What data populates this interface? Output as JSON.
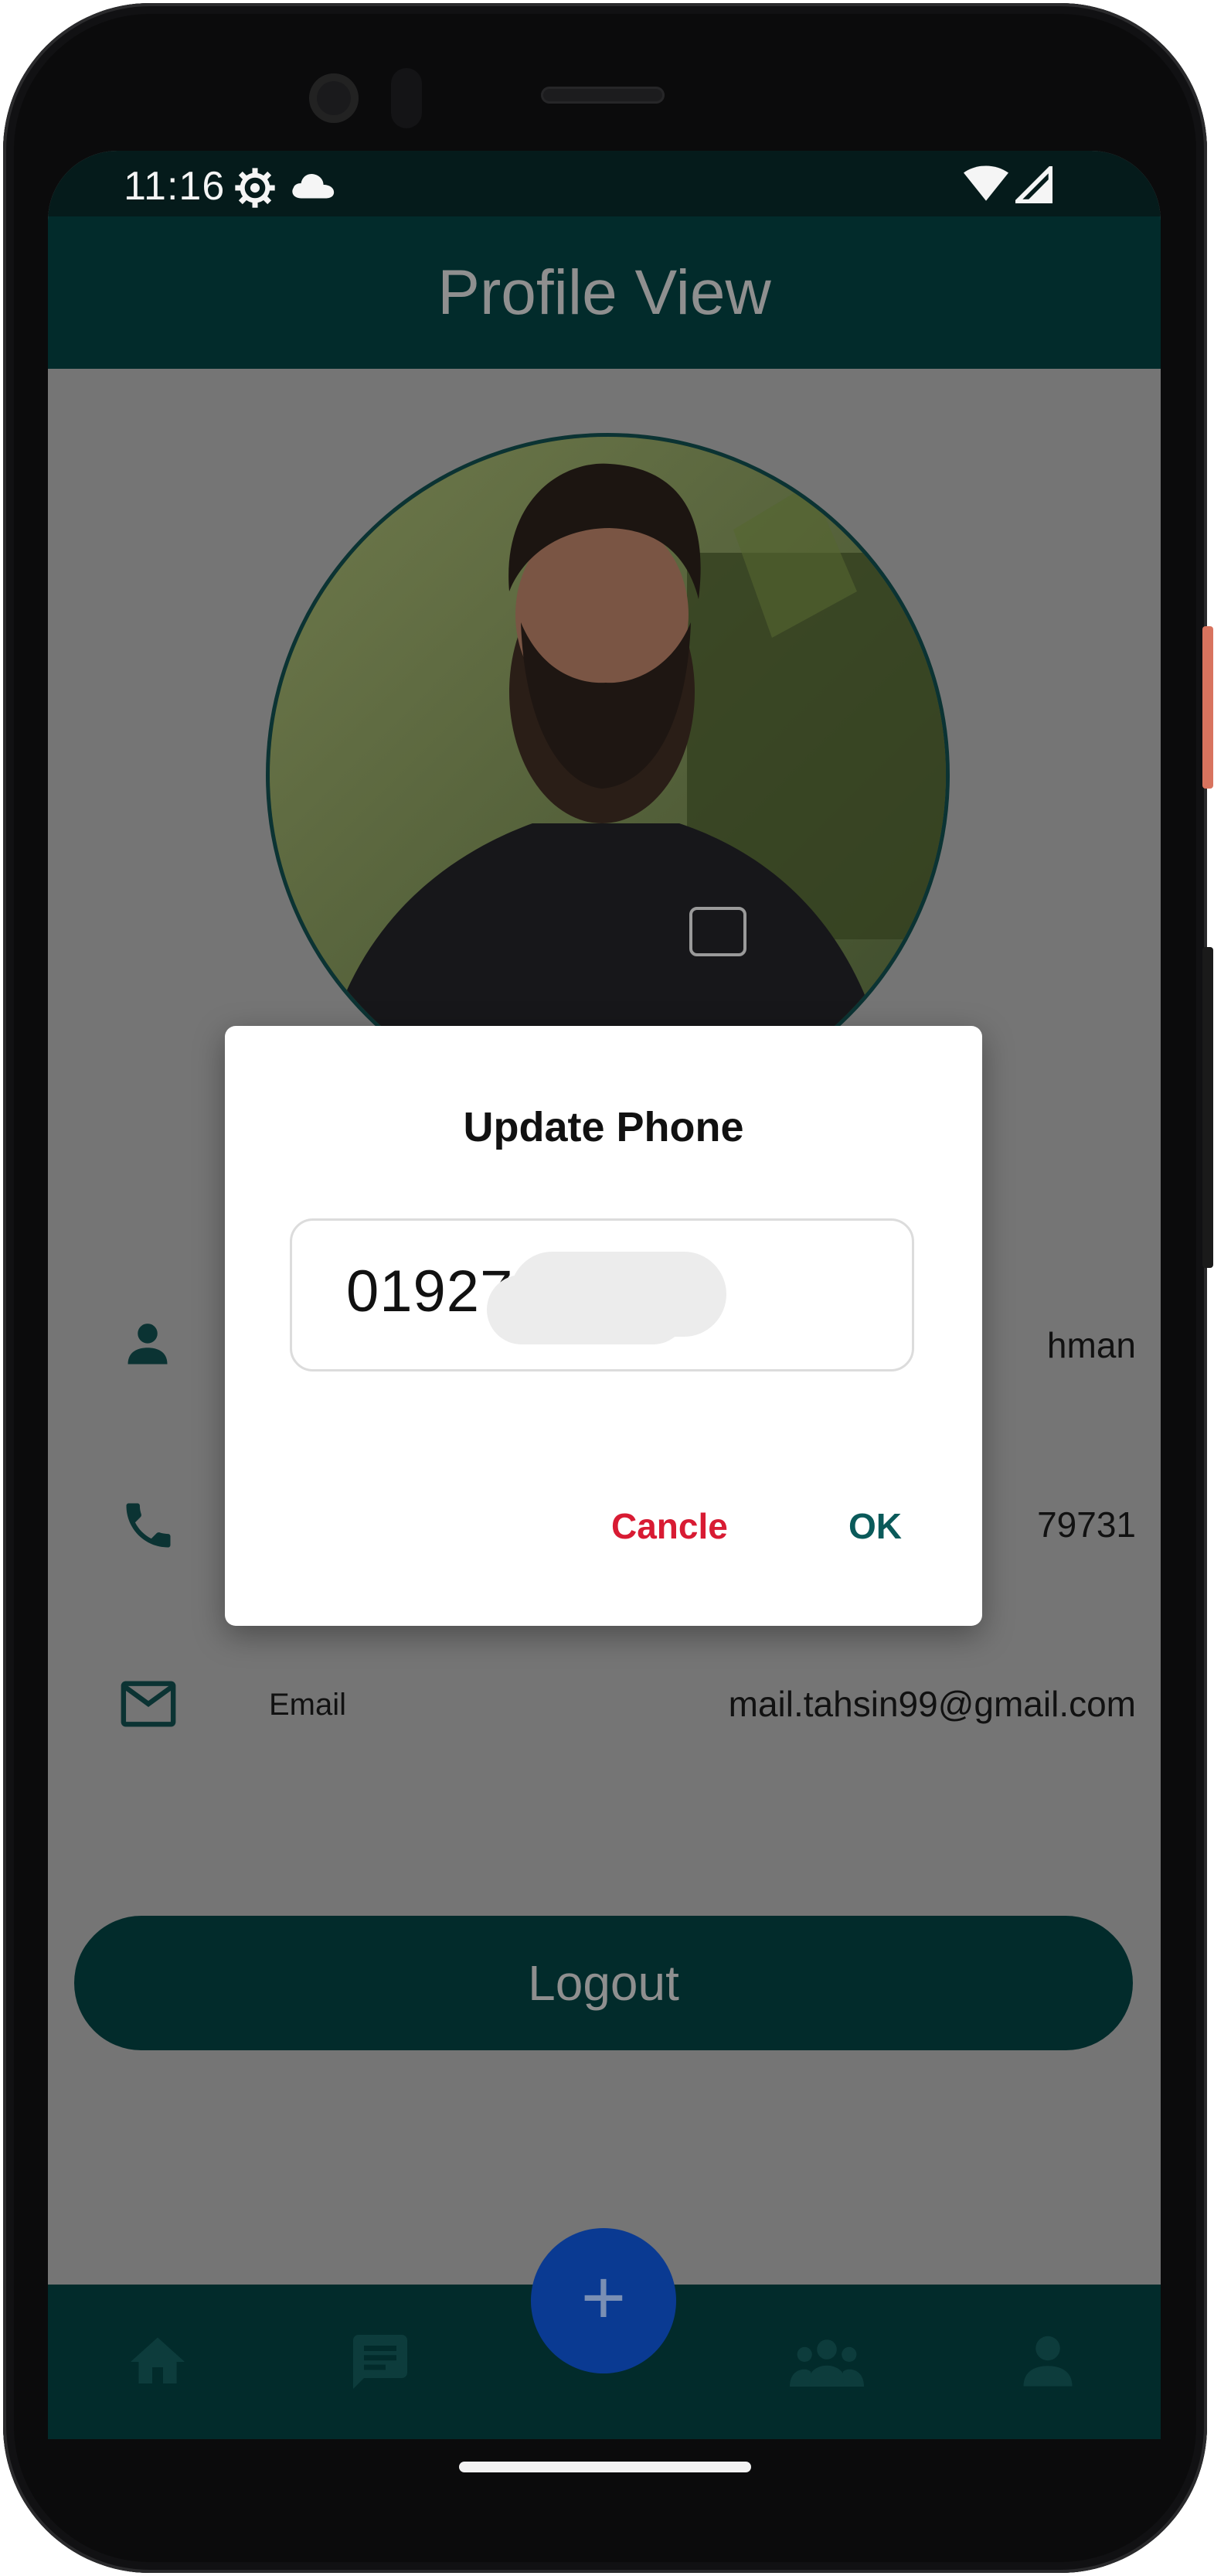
{
  "status_bar": {
    "time": "11:16",
    "icons": [
      "settings-gear-icon",
      "cloud-icon",
      "wifi-icon",
      "cell-signal-icon"
    ]
  },
  "app_bar": {
    "title": "Profile View"
  },
  "profile": {
    "rows": [
      {
        "icon": "person-icon",
        "label": "",
        "value": "hman"
      },
      {
        "icon": "phone-icon",
        "label": "",
        "value": "79731"
      },
      {
        "icon": "mail-icon",
        "label": "Email",
        "value": "mail.tahsin99@gmail.com"
      }
    ]
  },
  "logout_label": "Logout",
  "bottom_nav": {
    "items": [
      "home-icon",
      "chat-icon",
      "add-icon",
      "group-icon",
      "account-icon"
    ],
    "fab_label": "+"
  },
  "dialog": {
    "title": "Update Phone",
    "input_value": "01927",
    "cancel_label": "Cancle",
    "ok_label": "OK"
  },
  "colors": {
    "app_bar": "#022b2b",
    "fab": "#0a3a92",
    "cancel": "#d81b33",
    "ok": "#0a5a5a",
    "overlay_background": "#757575"
  }
}
